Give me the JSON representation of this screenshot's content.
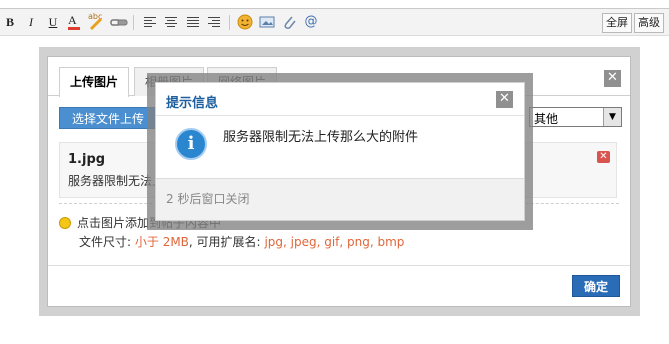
{
  "toolbar": {
    "bold": "B",
    "italic": "I",
    "underline": "U",
    "font_color": "A",
    "spellcheck": "abc",
    "fullscreen": "全屏",
    "advanced": "高级"
  },
  "upload_dialog": {
    "tabs": [
      {
        "label": "上传图片"
      },
      {
        "label": "相册图片"
      },
      {
        "label": "网络图片"
      }
    ],
    "select_button": "选择文件上传",
    "dropdown_value": "其他",
    "file": {
      "name": "1.jpg",
      "message": "服务器限制无法上传那么大的附件"
    },
    "hint_text": "点击图片添加到帖子内容中",
    "size_label": "文件尺寸:",
    "size_value": "小于 2MB",
    "ext_label": ", 可用扩展名:",
    "ext_value": "jpg, jpeg, gif, png, bmp",
    "confirm_button": "确定"
  },
  "message_box": {
    "title": "提示信息",
    "text": "服务器限制无法上传那么大的附件",
    "footer": "2 秒后窗口关闭"
  },
  "colors": {
    "accent": "#2a6db6",
    "highlight": "#e0663a",
    "title": "#1d5e9e"
  }
}
